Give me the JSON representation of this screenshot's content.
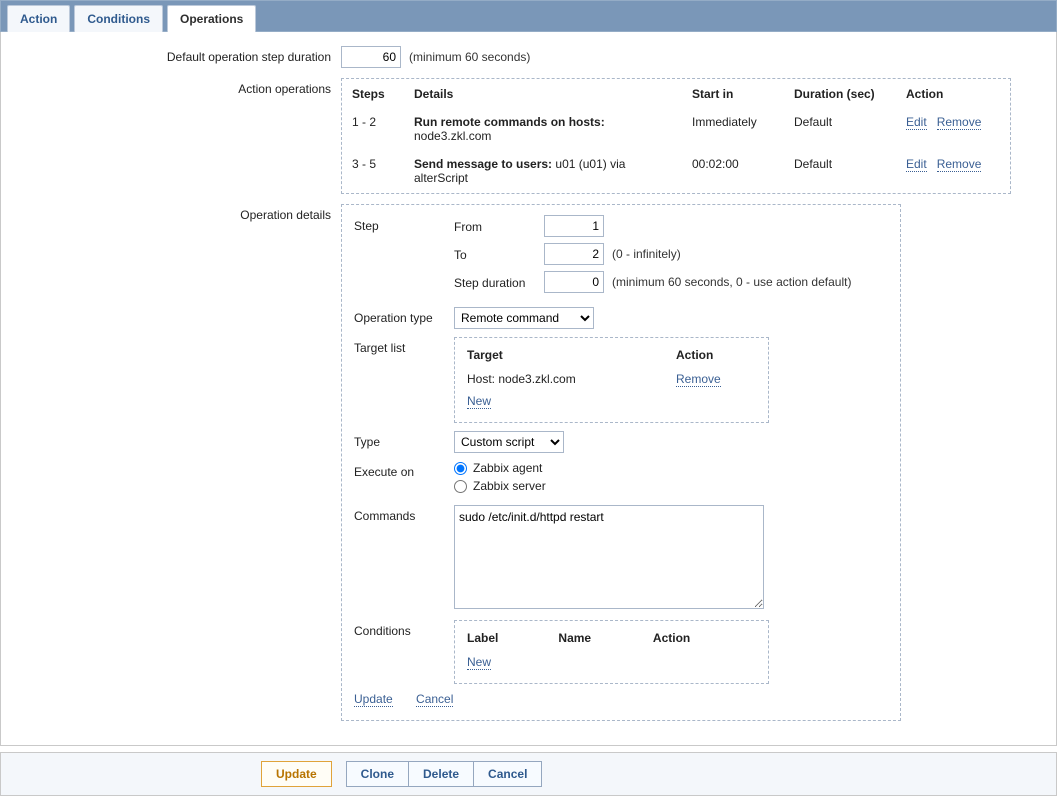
{
  "tabs": {
    "action": "Action",
    "conditions": "Conditions",
    "operations": "Operations"
  },
  "labels": {
    "default_step_duration": "Default operation step duration",
    "min_60": "(minimum 60 seconds)",
    "action_operations": "Action operations",
    "operation_details": "Operation details"
  },
  "default_step_duration_value": "60",
  "ops_table": {
    "cols": {
      "steps": "Steps",
      "details": "Details",
      "start_in": "Start in",
      "duration": "Duration (sec)",
      "action": "Action"
    },
    "rows": [
      {
        "steps": "1 - 2",
        "details_bold": "Run remote commands on hosts:",
        "details_rest": " node3.zkl.com",
        "start_in": "Immediately",
        "duration": "Default"
      },
      {
        "steps": "3 - 5",
        "details_bold": "Send message to users:",
        "details_rest": " u01 (u01) via alterScript",
        "start_in": "00:02:00",
        "duration": "Default"
      }
    ],
    "edit": "Edit",
    "remove": "Remove"
  },
  "details": {
    "step_label": "Step",
    "from_label": "From",
    "from_value": "1",
    "to_label": "To",
    "to_value": "2",
    "to_hint": "(0 - infinitely)",
    "dur_label": "Step duration",
    "dur_value": "0",
    "dur_hint": "(minimum 60 seconds, 0 - use action default)",
    "op_type_label": "Operation type",
    "op_type_value": "Remote command",
    "target_list_label": "Target list",
    "target_cols": {
      "target": "Target",
      "action": "Action"
    },
    "target_row": {
      "target": "Host: node3.zkl.com",
      "action": "Remove"
    },
    "new": "New",
    "type_label": "Type",
    "type_value": "Custom script",
    "execute_on_label": "Execute on",
    "exec_agent": "Zabbix agent",
    "exec_server": "Zabbix server",
    "commands_label": "Commands",
    "commands_value": "sudo /etc/init.d/httpd restart",
    "conditions_label": "Conditions",
    "cond_cols": {
      "label": "Label",
      "name": "Name",
      "action": "Action"
    },
    "update": "Update",
    "cancel": "Cancel"
  },
  "footer": {
    "update": "Update",
    "clone": "Clone",
    "delete": "Delete",
    "cancel": "Cancel"
  }
}
